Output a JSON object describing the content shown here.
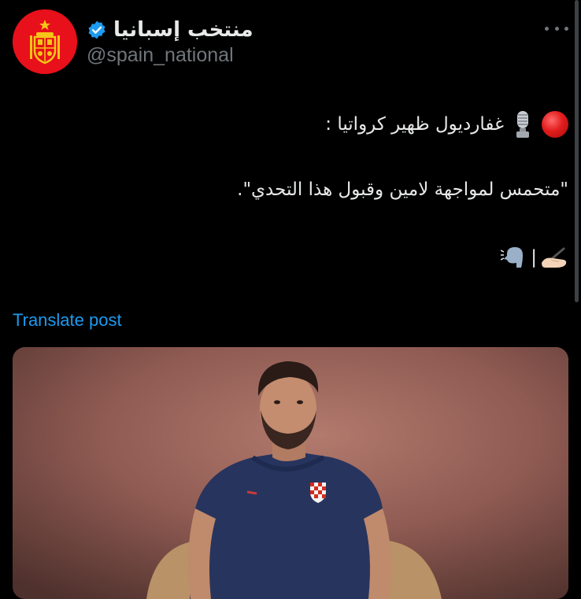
{
  "account": {
    "display_name": "منتخب إسبانيا",
    "handle": "@spain_national",
    "verified": true,
    "avatar_icon": "spain-crest-icon"
  },
  "post": {
    "line1": "غفارديول ظهير كرواتيا :",
    "line2": "\"متحمس لمواجهة لامين وقبول هذا التحدي\".",
    "line3_separator": "|",
    "line1_icons": [
      "red-circle-icon",
      "microphone-icon"
    ],
    "line3_icons": [
      "writing-hand-icon",
      "speaking-head-icon"
    ]
  },
  "actions": {
    "translate": "Translate post"
  },
  "colors": {
    "background": "#000000",
    "text": "#e7e9ea",
    "secondary": "#71767b",
    "link": "#1d9bf0",
    "verified": "#1d9bf0",
    "avatar": "#e8101a"
  }
}
